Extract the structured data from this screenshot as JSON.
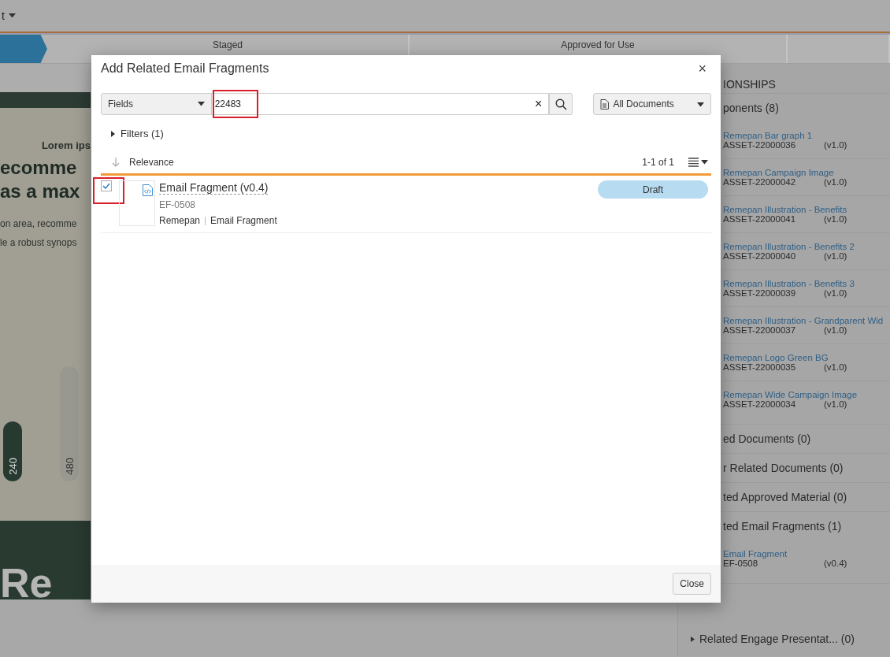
{
  "top_bar": {
    "menu_label": "t"
  },
  "stepper": {
    "steps": [
      {
        "selected": true
      },
      {
        "label": "Staged",
        "selected": false
      },
      {
        "label": "Approved for Use",
        "selected": false
      },
      {
        "selected": false
      }
    ]
  },
  "preview": {
    "eyebrow": "Lorem ips",
    "heading_lines": [
      "ecomme",
      "as a max"
    ],
    "body_lines": [
      "on area, recomme",
      "le a robust synops"
    ],
    "bars": [
      {
        "label": "240",
        "selected": true
      },
      {
        "label": "480",
        "selected": false
      }
    ],
    "banner_text": "Re"
  },
  "relationships": {
    "title": "IONSHIPS",
    "sections": [
      {
        "label": "ponents (8)",
        "items": [
          {
            "name": "Remepan Bar graph 1",
            "id": "ASSET-22000036",
            "version": "(v1.0)"
          },
          {
            "name": "Remepan Campaign Image",
            "id": "ASSET-22000042",
            "version": "(v1.0)"
          },
          {
            "name": "Remepan Illustration - Benefits",
            "id": "ASSET-22000041",
            "version": "(v1.0)"
          },
          {
            "name": "Remepan Illustration - Benefits 2",
            "id": "ASSET-22000040",
            "version": "(v1.0)"
          },
          {
            "name": "Remepan Illustration - Benefits 3",
            "id": "ASSET-22000039",
            "version": "(v1.0)"
          },
          {
            "name": "Remepan Illustration - Grandparent Wid",
            "id": "ASSET-22000037",
            "version": "(v1.0)"
          },
          {
            "name": "Remepan Logo Green BG",
            "id": "ASSET-22000035",
            "version": "(v1.0)"
          },
          {
            "name": "Remepan Wide Campaign Image",
            "id": "ASSET-22000034",
            "version": "(v1.0)"
          }
        ]
      },
      {
        "label": "ed Documents (0)"
      },
      {
        "label": "r Related Documents (0)"
      },
      {
        "label": "ted Approved Material (0)"
      },
      {
        "label": "ted Email Fragments (1)",
        "items": [
          {
            "name": "Email Fragment",
            "id": "EF-0508",
            "version": "(v0.4)"
          }
        ]
      }
    ],
    "footer_section": {
      "label": "Related Engage Presentat... (0)",
      "expanded": false
    }
  },
  "dialog": {
    "title": "Add Related Email Fragments",
    "close": "×",
    "search": {
      "field_selector": "Fields",
      "value": "22483",
      "clear": "×",
      "highlighted": true
    },
    "scope": "All Documents",
    "filters": "Filters (1)",
    "sort": "Relevance",
    "count": "1-1 of 1",
    "results": [
      {
        "checked": true,
        "highlighted": true,
        "title": "Email Fragment (v0.4)",
        "id": "EF-0508",
        "brand": "Remepan",
        "type": "Email Fragment",
        "status": "Draft"
      }
    ],
    "footer_button": "Close"
  }
}
